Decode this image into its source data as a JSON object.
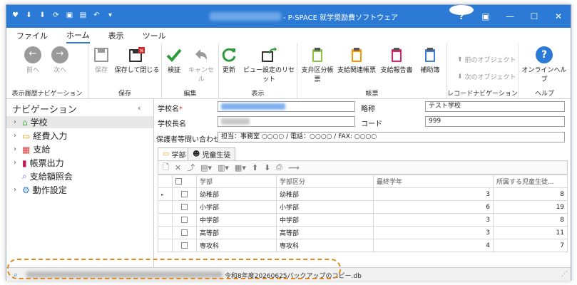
{
  "title": {
    "app": "- P-SPACE 就学奨励費ソフトウェア"
  },
  "menu": {
    "items": [
      "ファイル",
      "ホーム",
      "表示",
      "ツール"
    ],
    "active": "ホーム"
  },
  "ribbon": {
    "nav": {
      "prev": "前へ",
      "next": "次へ",
      "label": "表示履歴ナビゲーション"
    },
    "save": {
      "save": "保存",
      "save_close": "保存して閉じる",
      "label": "保存"
    },
    "edit": {
      "verify": "検証",
      "cancel": "キャンセル",
      "label": "編集"
    },
    "view": {
      "refresh": "更新",
      "reset": "ビュー設定のリセット",
      "label": "表示"
    },
    "forms": {
      "b1": "支弁区分帳票",
      "b2": "支給関連帳票",
      "b3": "支給報告書",
      "b4": "補助簿",
      "label": "帳票"
    },
    "recnav": {
      "prev": "前のオブジェクト",
      "next": "次のオブジェクト",
      "label": "レコードナビゲーション"
    },
    "help": {
      "online": "オンラインヘルプ",
      "label": "ヘルプ"
    }
  },
  "nav": {
    "header": "ナビゲーション",
    "items": [
      {
        "label": "学校",
        "arrow": "›"
      },
      {
        "label": "経費入力",
        "arrow": "›"
      },
      {
        "label": "支給",
        "arrow": "›"
      },
      {
        "label": "帳票出力",
        "arrow": "›"
      },
      {
        "label": "支給額照会",
        "arrow": ""
      },
      {
        "label": "動作設定",
        "arrow": "›"
      }
    ]
  },
  "form": {
    "school_name_label": "学校名",
    "required_mark": "*",
    "abbr_label": "略称",
    "abbr_value": "テスト学校",
    "principal_label": "学校長名",
    "code_label": "コード",
    "code_value": "999",
    "contact_label": "保護者等問い合わせ先",
    "contact_value": "担当：事務室 ○○○○ / 電話：○○○○ / FAX: ○○○○"
  },
  "tabs": {
    "t1": "学部",
    "t2": "児童生徒"
  },
  "grid": {
    "headers": [
      "学部",
      "学部区分",
      "最終学年",
      "所属する児童生徒..."
    ],
    "rows": [
      {
        "dept": "幼稚部",
        "kind": "幼稚部",
        "grade": "3",
        "count": "8"
      },
      {
        "dept": "小学部",
        "kind": "小学部",
        "grade": "6",
        "count": "19"
      },
      {
        "dept": "中学部",
        "kind": "中学部",
        "grade": "3",
        "count": "8"
      },
      {
        "dept": "高等部",
        "kind": "高等部",
        "grade": "3",
        "count": "11"
      },
      {
        "dept": "専攻科",
        "kind": "専攻科",
        "grade": "4",
        "count": "7"
      }
    ]
  },
  "status": {
    "file": "令和8年度20260625バックアップのコピー.db"
  }
}
